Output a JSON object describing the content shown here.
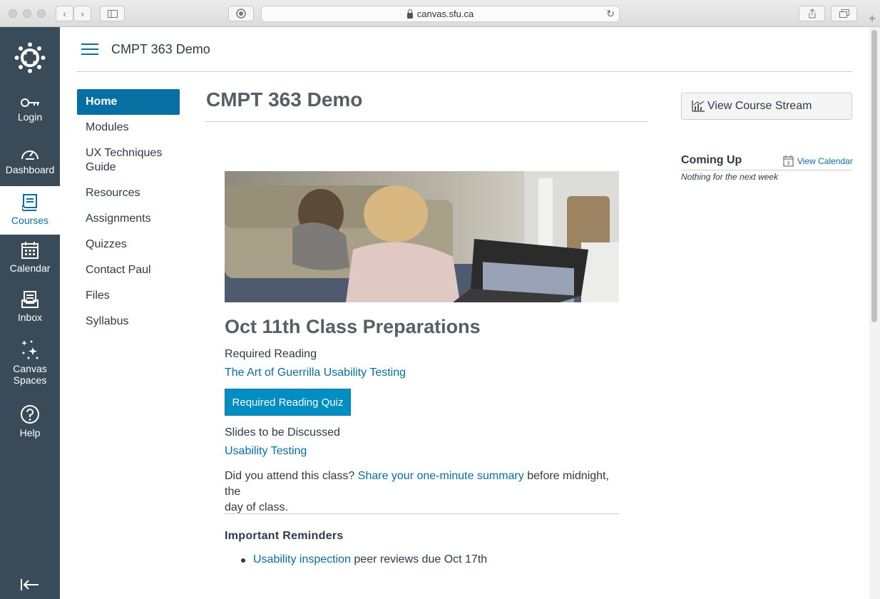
{
  "browser": {
    "url": "canvas.sfu.ca"
  },
  "global_nav": {
    "items": [
      {
        "label": "Login",
        "icon": "key-icon"
      },
      {
        "label": "Dashboard",
        "icon": "dashboard-icon"
      },
      {
        "label": "Courses",
        "icon": "courses-icon",
        "active": true
      },
      {
        "label": "Calendar",
        "icon": "calendar-icon"
      },
      {
        "label": "Inbox",
        "icon": "inbox-icon"
      },
      {
        "label": "Canvas",
        "label2": "Spaces",
        "icon": "sparkles-icon"
      },
      {
        "label": "Help",
        "icon": "help-icon"
      }
    ],
    "colors": {
      "bg": "#394b58",
      "accent": "#0770a3"
    }
  },
  "header": {
    "breadcrumb": "CMPT 363 Demo"
  },
  "course_nav": {
    "items": [
      "Home",
      "Modules",
      "UX Techniques Guide",
      "Resources",
      "Assignments",
      "Quizzes",
      "Contact Paul",
      "Files",
      "Syllabus"
    ]
  },
  "main": {
    "title": "CMPT 363 Demo",
    "section_title": "Oct 11th Class Preparations",
    "required_reading_label": "Required Reading",
    "reading_link": "The Art of Guerrilla Usability Testing",
    "quiz_button": "Required Reading Quiz",
    "slides_label": "Slides to be Discussed",
    "slides_link": "Usability Testing",
    "attend_pre": "Did you attend this class? ",
    "attend_link": "Share your one-minute summary",
    "attend_post": " before midnight, the",
    "attend_line2": "day of class.",
    "reminders_title": "Important Reminders",
    "reminder_link": "Usability inspection",
    "reminder_text": " peer reviews due Oct 17th"
  },
  "sidebar": {
    "stream_button": "View Course Stream",
    "coming_up": "Coming Up",
    "view_calendar": "View Calendar",
    "calendar_day": "3",
    "nothing": "Nothing for the next week"
  }
}
